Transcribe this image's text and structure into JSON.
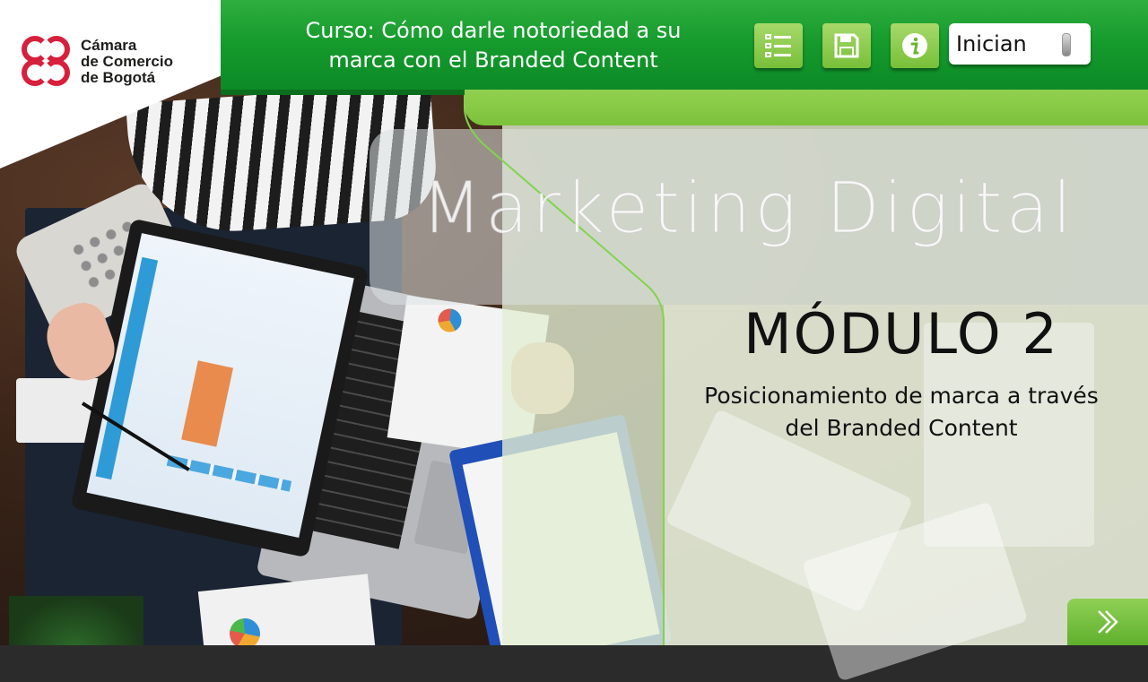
{
  "brand": {
    "logo_line1": "Cámara",
    "logo_line2": "de Comercio",
    "logo_line3": "de Bogotá",
    "color_red": "#d6203c"
  },
  "header": {
    "course_title_line1": "Curso: Cómo darle notoriedad a su",
    "course_title_line2": "marca con el Branded Content",
    "color_green": "#159a2c"
  },
  "toolbar": {
    "menu_icon": "list-menu-icon",
    "save_icon": "save-icon",
    "info_icon": "info-icon",
    "sound_label": "Inician",
    "color_button": "#8fce50"
  },
  "main": {
    "watermark": "Marketing Digital",
    "module_title": "MÓDULO 2",
    "subtitle_line1": "Posicionamiento de marca a través",
    "subtitle_line2": "del Branded Content"
  },
  "navigation": {
    "next_icon": "double-chevron-right-icon"
  }
}
